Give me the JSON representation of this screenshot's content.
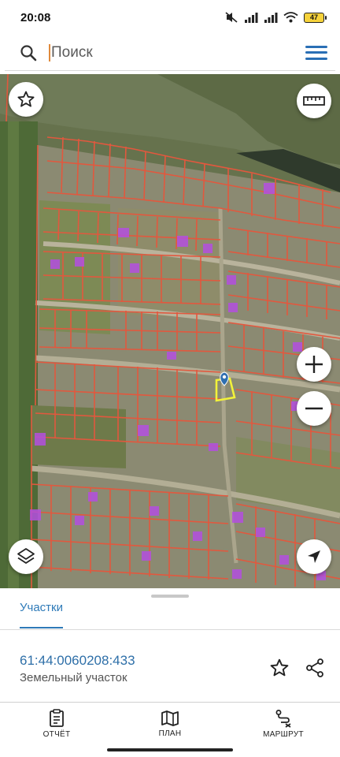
{
  "status": {
    "time": "20:08",
    "battery": "47",
    "icons": [
      "mute-icon",
      "signal-icon",
      "signal-icon",
      "wifi-icon",
      "battery-icon"
    ]
  },
  "search": {
    "placeholder": "Поиск",
    "icon": "search-icon",
    "menu_icon": "hamburger-menu-icon"
  },
  "map": {
    "controls": [
      "star-icon",
      "ruler-icon",
      "plus-icon",
      "minus-icon",
      "layers-icon",
      "navigation-arrow-icon"
    ],
    "parcel_color": "#e2583e",
    "building_color": "#b44fe0",
    "selected_color": "#f2f23a",
    "pin_color": "#2f6fb0"
  },
  "sheet": {
    "tab_label": "Участки",
    "parcel_id": "61:44:0060208:433",
    "parcel_type": "Земельный участок",
    "accent": "#2e7ab8"
  },
  "nav": {
    "items": [
      {
        "label": "ОТЧЁТ",
        "icon": "report-icon"
      },
      {
        "label": "ПЛАН",
        "icon": "map-plan-icon"
      },
      {
        "label": "МАРШРУТ",
        "icon": "route-icon"
      }
    ]
  }
}
